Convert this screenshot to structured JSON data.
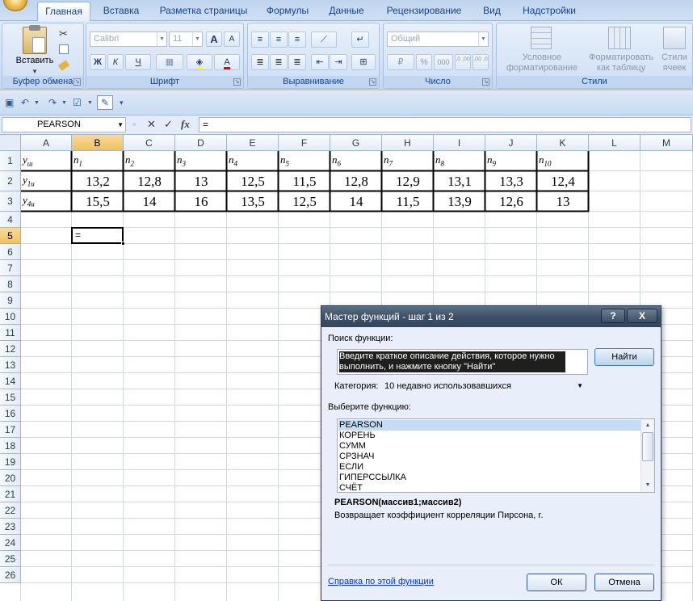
{
  "ribbon": {
    "tabs": [
      "Главная",
      "Вставка",
      "Разметка страницы",
      "Формулы",
      "Данные",
      "Рецензирование",
      "Вид",
      "Надстройки"
    ],
    "active_tab": "Главная",
    "clipboard": {
      "paste_label": "Вставить",
      "group_label": "Буфер обмена"
    },
    "font": {
      "font_name": "Calibri",
      "font_size": "11",
      "bold": "Ж",
      "italic": "К",
      "underline": "Ч",
      "grow": "A",
      "shrink": "A",
      "color": "A",
      "group_label": "Шрифт"
    },
    "alignment": {
      "group_label": "Выравнивание"
    },
    "number": {
      "format": "Общий",
      "percent": "%",
      "thousands": "000",
      "inc_decimal": ",0 ,00",
      "dec_decimal": ",00 ,0",
      "group_label": "Число"
    },
    "styles": {
      "conditional": "Условное форматирование",
      "as_table": "Форматировать как таблицу",
      "cell_styles": "Стили ячеек",
      "group_label": "Стили"
    }
  },
  "formula_bar": {
    "name_box": "PEARSON",
    "fx": "fx",
    "cancel": "✕",
    "enter": "✓",
    "content": "="
  },
  "sheet": {
    "columns": [
      "A",
      "B",
      "C",
      "D",
      "E",
      "F",
      "G",
      "H",
      "I",
      "J",
      "K",
      "L",
      "M"
    ],
    "selected_column": "B",
    "rows": [
      "1",
      "2",
      "3",
      "4",
      "5",
      "6",
      "7",
      "8",
      "9",
      "10",
      "11",
      "12",
      "13",
      "14",
      "15",
      "16",
      "17",
      "18",
      "19",
      "20",
      "21",
      "22",
      "23",
      "24",
      "25",
      "26"
    ],
    "selected_row": "5",
    "row_labels": [
      {
        "base": "y",
        "sub": "ш"
      },
      {
        "base": "y",
        "sub": "1и"
      },
      {
        "base": "y",
        "sub": "4и"
      }
    ],
    "header_cols": [
      {
        "base": "n",
        "sub": "1"
      },
      {
        "base": "n",
        "sub": "2"
      },
      {
        "base": "n",
        "sub": "3"
      },
      {
        "base": "n",
        "sub": "4"
      },
      {
        "base": "n",
        "sub": "5"
      },
      {
        "base": "n",
        "sub": "6"
      },
      {
        "base": "n",
        "sub": "7"
      },
      {
        "base": "n",
        "sub": "8"
      },
      {
        "base": "n",
        "sub": "9"
      },
      {
        "base": "n",
        "sub": "10"
      }
    ],
    "row2": [
      "13,2",
      "12,8",
      "13",
      "12,5",
      "11,5",
      "12,8",
      "12,9",
      "13,1",
      "13,3",
      "12,4"
    ],
    "row3": [
      "15,5",
      "14",
      "16",
      "13,5",
      "12,5",
      "14",
      "11,5",
      "13,9",
      "12,6",
      "13"
    ],
    "active_cell_value": "="
  },
  "dialog": {
    "title": "Мастер функций - шаг 1 из 2",
    "help_btn": "?",
    "close_btn": "X",
    "search_label": "Поиск функции:",
    "search_text": "Введите краткое описание действия, которое нужно выполнить, и нажмите кнопку \"Найти\"",
    "find_button": "Найти",
    "category_label": "Категория:",
    "category_value": "10 недавно использовавшихся",
    "choose_label": "Выберите функцию:",
    "functions": [
      "PEARSON",
      "КОРЕНЬ",
      "СУММ",
      "СРЗНАЧ",
      "ЕСЛИ",
      "ГИПЕРССЫЛКА",
      "СЧЁТ"
    ],
    "selected_function": "PEARSON",
    "signature": "PEARSON(массив1;массив2)",
    "description": "Возвращает коэффициент корреляции Пирсона, r.",
    "help_link": "Справка по этой функции",
    "ok": "ОК",
    "cancel": "Отмена"
  }
}
